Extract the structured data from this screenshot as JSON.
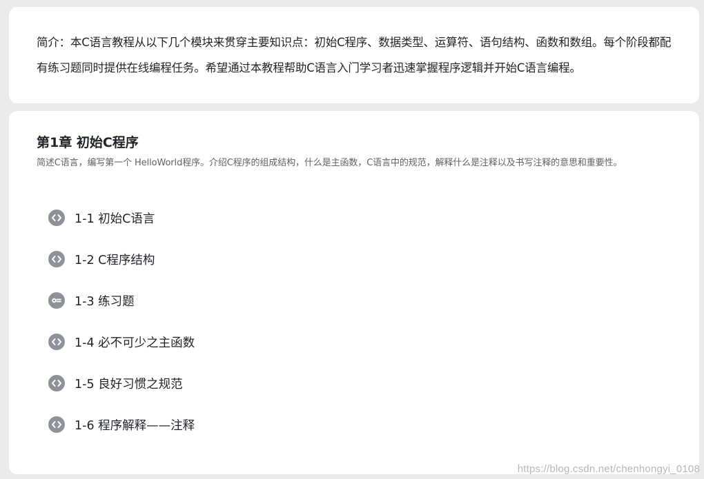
{
  "intro": {
    "text": "简介：本C语言教程从以下几个模块来贯穿主要知识点：初始C程序、数据类型、运算符、语句结构、函数和数组。每个阶段都配有练习题同时提供在线编程任务。希望通过本教程帮助C语言入门学习者迅速掌握程序逻辑并开始C语言编程。"
  },
  "chapter": {
    "title": "第1章 初始C程序",
    "description": "简述C语言，编写第一个 HelloWorld程序。介绍C程序的组成结构，什么是主函数，C语言中的规范，解释什么是注释以及书写注释的意思和重要性。",
    "lessons": [
      {
        "label": "1-1 初始C语言",
        "icon": "code-icon"
      },
      {
        "label": "1-2 C程序结构",
        "icon": "code-icon"
      },
      {
        "label": "1-3 练习题",
        "icon": "exercise-icon"
      },
      {
        "label": "1-4 必不可少之主函数",
        "icon": "code-icon"
      },
      {
        "label": "1-5 良好习惯之规范",
        "icon": "code-icon"
      },
      {
        "label": "1-6 程序解释——注释",
        "icon": "code-icon"
      }
    ]
  },
  "watermark": "https://blog.csdn.net/chenhongyi_0108",
  "colors": {
    "background": "#e9eaec",
    "card": "#ffffff",
    "text": "#1f2329",
    "muted": "#5f6368",
    "icon": "#8d9299"
  }
}
